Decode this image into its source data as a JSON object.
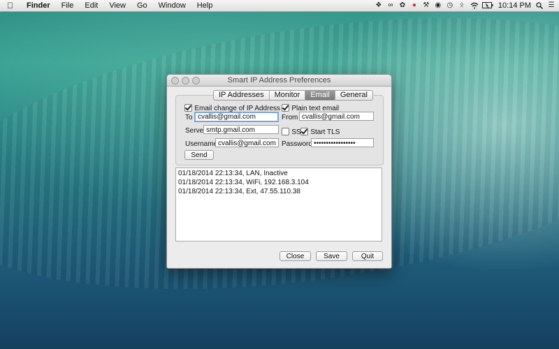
{
  "menubar": {
    "apple_icon": "apple-icon",
    "items": [
      "Finder",
      "File",
      "Edit",
      "View",
      "Go",
      "Window",
      "Help"
    ],
    "clock": "10:14 PM",
    "status_icons": [
      "dropbox-icon",
      "paperclip-icon",
      "leaf-icon",
      "chrome-icon",
      "wrench-icon",
      "record-icon",
      "time-machine-icon",
      "bluetooth-icon",
      "wifi-icon",
      "battery-icon",
      "search-icon",
      "list-icon"
    ]
  },
  "window": {
    "title": "Smart IP Address Preferences",
    "tabs": [
      "IP Addresses",
      "Monitor",
      "Email",
      "General"
    ],
    "active_tab": "Email",
    "email_change_label": "Email change of IP Address",
    "email_change_checked": true,
    "plain_text_label": "Plain text email",
    "plain_text_checked": true,
    "to_label": "To",
    "to_value": "cvallis@gmail.com",
    "from_label": "From",
    "from_value": "cvallis@gmail.com",
    "server_label": "Server",
    "server_value": "smtp.gmail.com",
    "ssl_label": "SSL",
    "ssl_checked": false,
    "tls_label": "Start TLS",
    "tls_checked": true,
    "username_label": "Username",
    "username_value": "cvallis@gmail.com",
    "password_label": "Password",
    "password_value": "•••••••••••••••••",
    "send_label": "Send",
    "log": [
      "01/18/2014 22:13:34, LAN, Inactive",
      "01/18/2014 22:13:34, WiFi, 192.168.3.104",
      "01/18/2014 22:13:34, Ext, 47.55.110.38"
    ],
    "close_label": "Close",
    "save_label": "Save",
    "quit_label": "Quit"
  }
}
